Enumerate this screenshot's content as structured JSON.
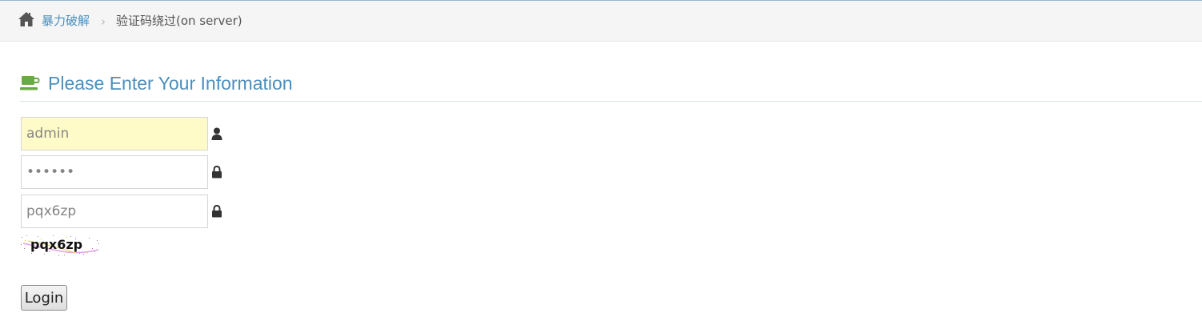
{
  "breadcrumb": {
    "home_icon": "home-icon",
    "parent_label": "暴力破解",
    "separator": "›",
    "current_label": "验证码绕过(on server)"
  },
  "form": {
    "title": "Please Enter Your Information",
    "title_icon": "coffee-cup-icon",
    "username": {
      "value": "admin",
      "icon": "user-icon"
    },
    "password": {
      "value": "••••••",
      "icon": "lock-icon"
    },
    "captcha_input": {
      "value": "pqx6zp",
      "icon": "lock-icon"
    },
    "captcha_image_text": "pqx6zp",
    "login_label": "Login"
  },
  "colors": {
    "accent": "#4c8fbd",
    "cup_green": "#69aa46",
    "autofill": "#fffbc8"
  }
}
